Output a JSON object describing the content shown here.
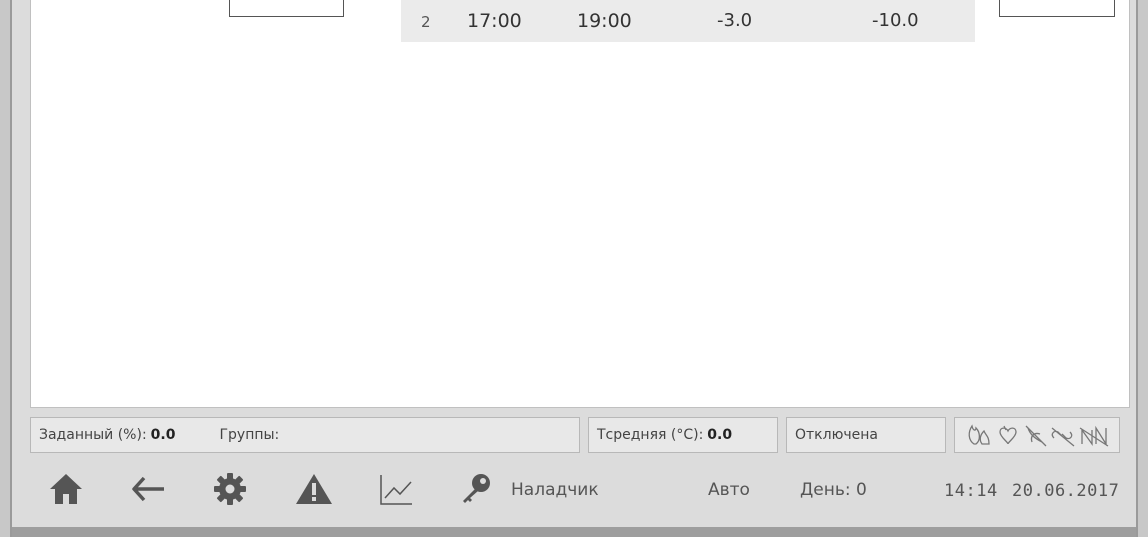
{
  "schedule_row": {
    "index": "2",
    "start_time": "17:00",
    "end_time": "19:00",
    "temp_min": "-3.0",
    "temp_max": "-10.0"
  },
  "status_bar": {
    "target_label": "Заданный (%):",
    "target_value": "0.0",
    "groups_label": "Группы:",
    "tavg_label": "Тсредняя (°C):",
    "tavg_value": "0.0",
    "state": "Отключена",
    "status_icons": [
      "flame-icon",
      "heart-icon",
      "fan-off-icon",
      "link-off-icon",
      "signal-off-icon"
    ]
  },
  "toolbar": {
    "icons": [
      "home-icon",
      "back-arrow-icon",
      "gear-icon",
      "warning-icon",
      "chart-icon",
      "key-icon"
    ],
    "user": "Наладчик",
    "mode": "Авто",
    "day": "День: 0",
    "time": "14:14",
    "date": "20.06.2017"
  },
  "colors": {
    "icon": "#555555",
    "background": "#dcdcdc",
    "panel": "#ffffff"
  }
}
